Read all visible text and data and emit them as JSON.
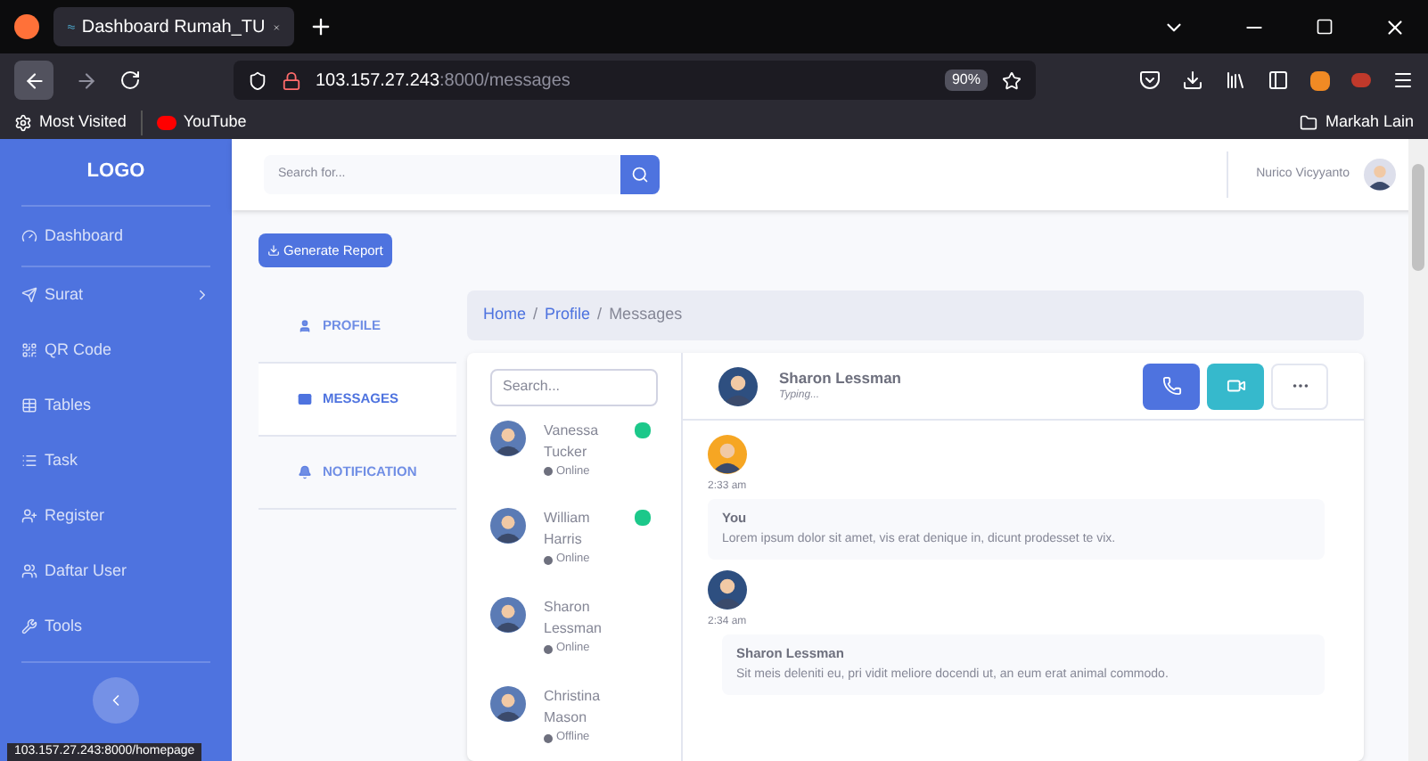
{
  "browser": {
    "tab_title": "Dashboard Rumah_TU",
    "url_host": "103.157.27.243",
    "url_path": ":8000/messages",
    "zoom": "90%",
    "bookmarks": [
      "Most Visited",
      "YouTube"
    ],
    "other_bookmarks": "Markah Lain"
  },
  "sidebar": {
    "logo": "LOGO",
    "items": [
      {
        "label": "Dashboard",
        "has_submenu": false
      },
      {
        "label": "Surat",
        "has_submenu": true
      },
      {
        "label": "QR Code",
        "has_submenu": false
      },
      {
        "label": "Tables",
        "has_submenu": false
      },
      {
        "label": "Task",
        "has_submenu": false
      },
      {
        "label": "Register",
        "has_submenu": false
      },
      {
        "label": "Daftar User",
        "has_submenu": false
      },
      {
        "label": "Tools",
        "has_submenu": false
      }
    ]
  },
  "topbar": {
    "search_placeholder": "Search for...",
    "user_name": "Nurico Vicyyanto"
  },
  "generate_button": "Generate Report",
  "profile_tabs": [
    {
      "label": "PROFILE",
      "selected": false
    },
    {
      "label": "MESSAGES",
      "selected": true
    },
    {
      "label": "NOTIFICATION",
      "selected": false
    }
  ],
  "breadcrumb": {
    "separator": "/",
    "items": [
      {
        "label": "Home",
        "link": true
      },
      {
        "label": "Profile",
        "link": true
      },
      {
        "label": "Messages",
        "link": false
      }
    ]
  },
  "contacts": {
    "search_placeholder": "Search...",
    "items": [
      {
        "name": "Vanessa Tucker",
        "status": "Online",
        "unread": true
      },
      {
        "name": "William Harris",
        "status": "Online",
        "unread": true
      },
      {
        "name": "Sharon Lessman",
        "status": "Online",
        "unread": false
      },
      {
        "name": "Christina Mason",
        "status": "Offline",
        "unread": false
      }
    ]
  },
  "chat": {
    "name": "Sharon Lessman",
    "status": "Typing...",
    "messages": [
      {
        "time": "2:33 am",
        "sender": "You",
        "text": "Lorem ipsum dolor sit amet, vis erat denique in, dicunt prodesset te vix.",
        "own": true
      },
      {
        "time": "2:34 am",
        "sender": "Sharon Lessman",
        "text": "Sit meis deleniti eu, pri vidit meliore docendi ut, an eum erat animal commodo.",
        "own": false
      }
    ]
  },
  "status_url": "103.157.27.243:8000/homepage"
}
